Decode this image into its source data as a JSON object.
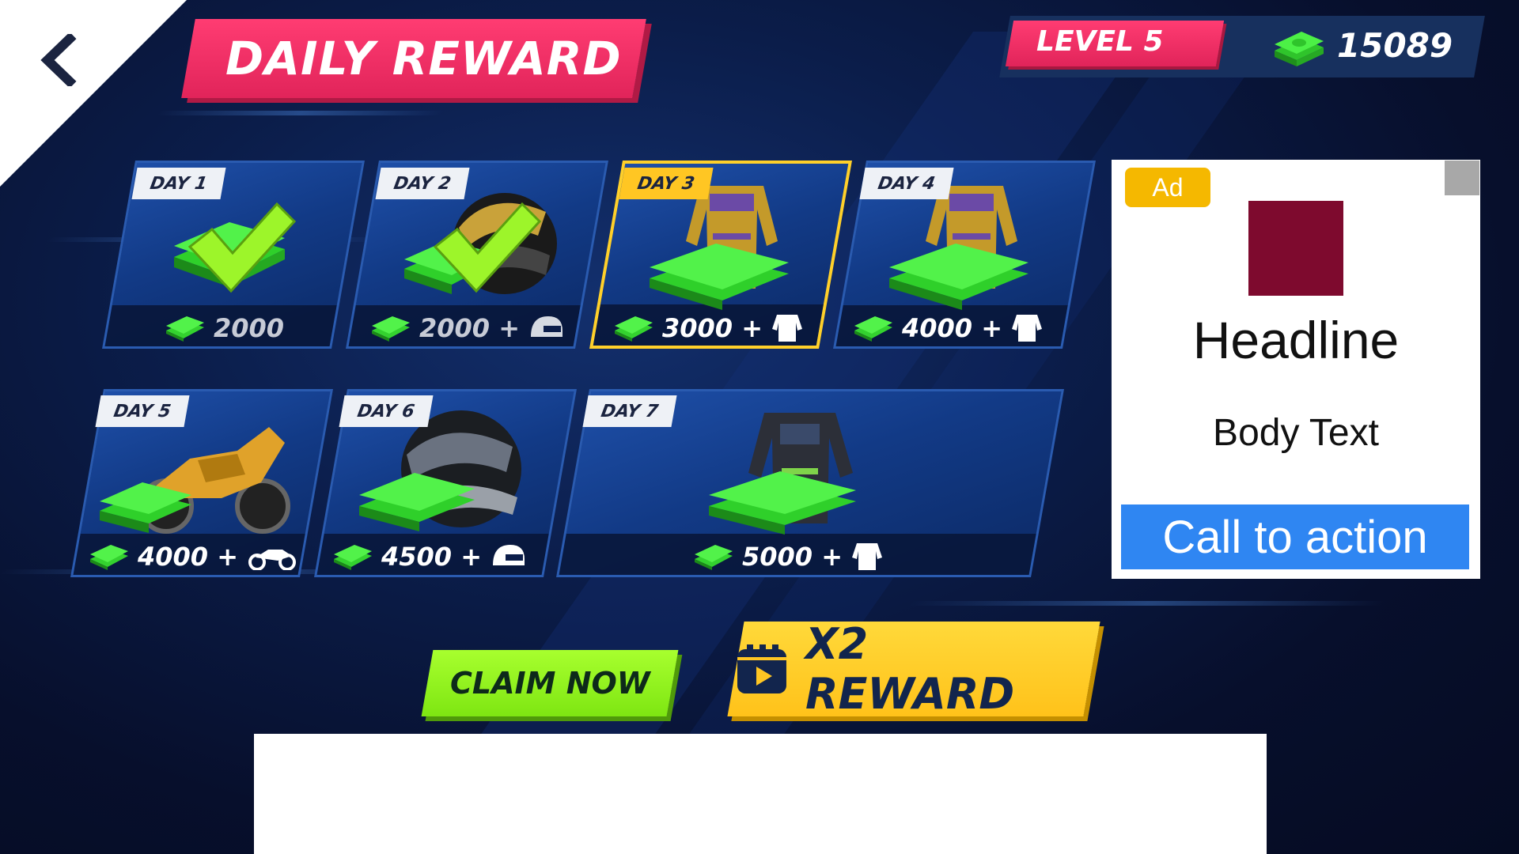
{
  "header": {
    "title": "DAILY REWARD",
    "level": "LEVEL 5",
    "coins": "15089"
  },
  "rewards": [
    {
      "day": "DAY 1",
      "amount": "2000",
      "bonus": "",
      "state": "claimed"
    },
    {
      "day": "DAY 2",
      "amount": "2000 +",
      "bonus": "helmet-icon",
      "state": "claimed"
    },
    {
      "day": "DAY 3",
      "amount": "3000 +",
      "bonus": "suit-icon",
      "state": "current"
    },
    {
      "day": "DAY 4",
      "amount": "4000 +",
      "bonus": "suit-icon",
      "state": "locked"
    },
    {
      "day": "DAY 5",
      "amount": "4000 +",
      "bonus": "motorbike-icon",
      "state": "locked"
    },
    {
      "day": "DAY 6",
      "amount": "4500 +",
      "bonus": "helmet-icon",
      "state": "locked"
    },
    {
      "day": "DAY 7",
      "amount": "5000 +",
      "bonus": "suit-icon",
      "state": "locked"
    }
  ],
  "buttons": {
    "claim": "CLAIM NOW",
    "x2": "X2 REWARD"
  },
  "ad": {
    "badge": "Ad",
    "headline": "Headline",
    "body": "Body Text",
    "cta": "Call to action"
  },
  "colors": {
    "accent_pink": "#e1245a",
    "claim_green": "#8cf01c",
    "x2_yellow": "#ffc623",
    "cash_green": "#3ee83a",
    "check_green": "#9df52a",
    "cta_blue": "#2f86f2"
  }
}
